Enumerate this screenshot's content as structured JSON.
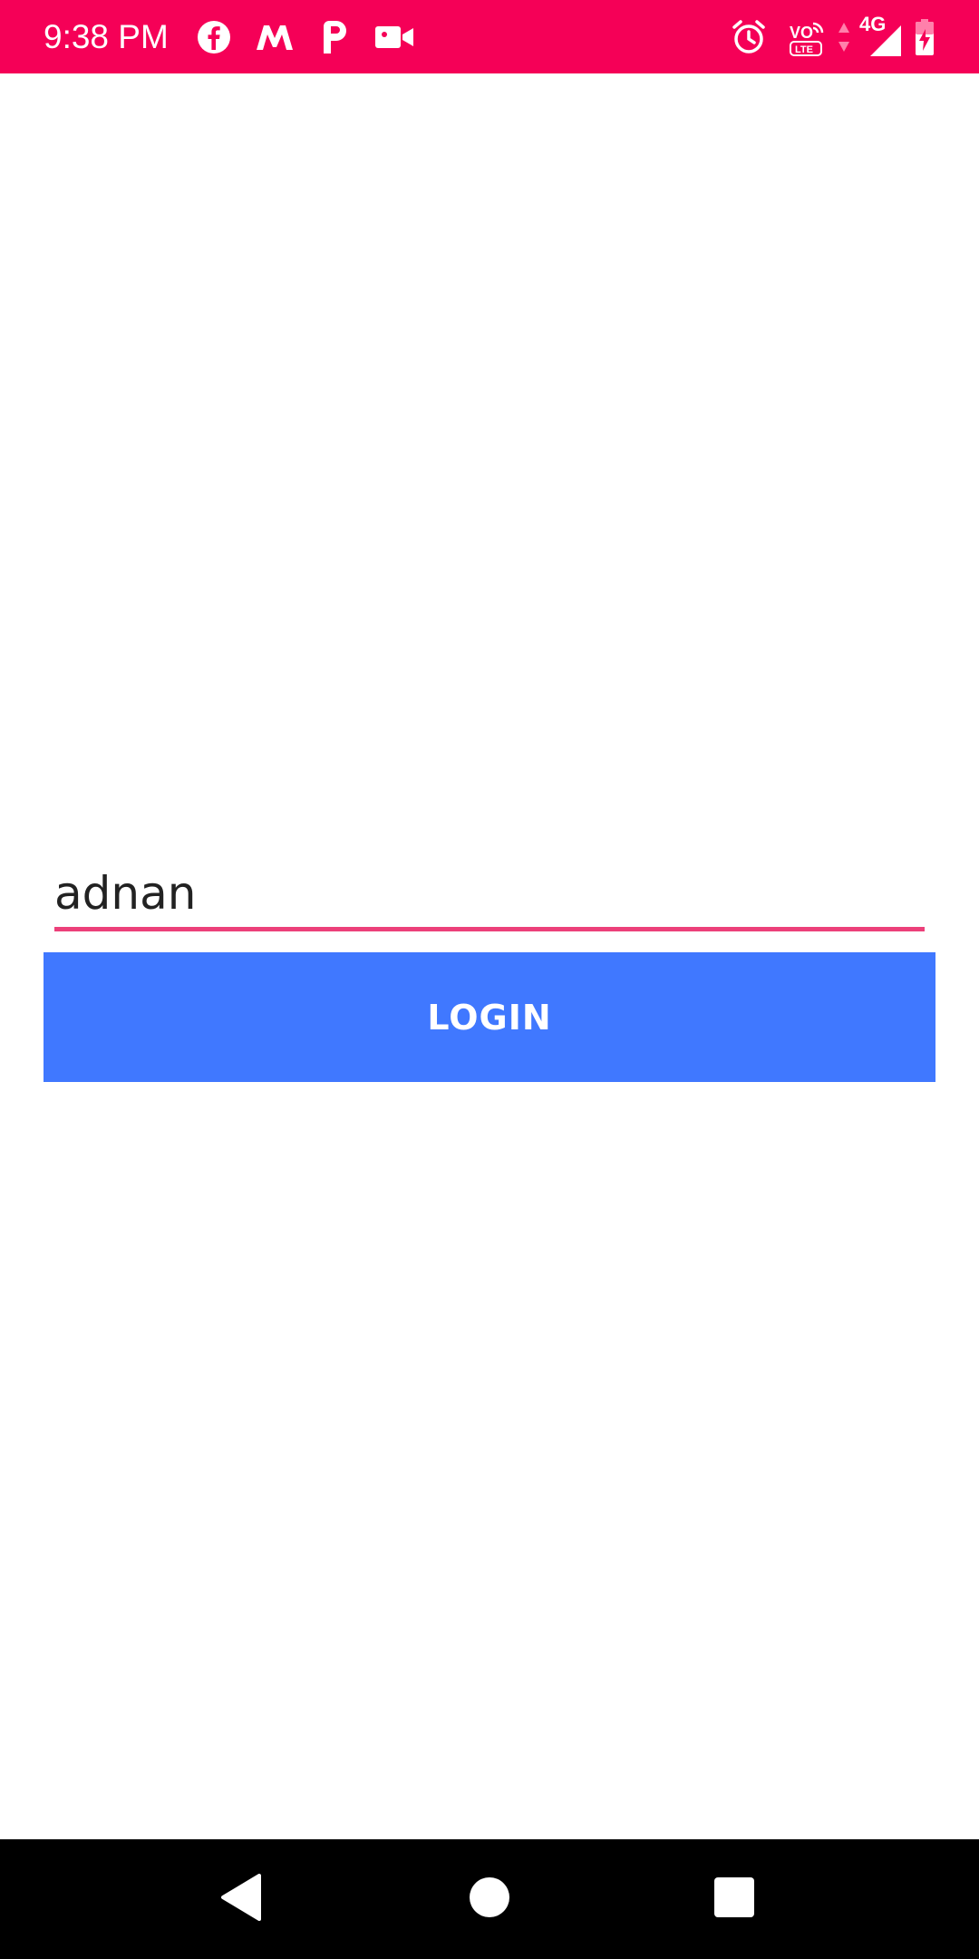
{
  "status_bar": {
    "time": "9:38 PM",
    "background_color": "#f50057",
    "notification_icons": [
      "facebook-icon",
      "myntra-icon",
      "paytm-icon",
      "video-camera-icon"
    ],
    "system_icons": [
      "alarm-icon",
      "volte-icon",
      "data-activity-icon",
      "signal-icon",
      "battery-charging-icon"
    ],
    "network_type": "4G"
  },
  "login_form": {
    "username_value": "adnan",
    "underline_color": "#ec407a",
    "login_label": "LOGIN",
    "button_color": "#4078ff"
  },
  "nav_bar": {
    "buttons": [
      "back-icon",
      "home-icon",
      "recents-icon"
    ]
  }
}
